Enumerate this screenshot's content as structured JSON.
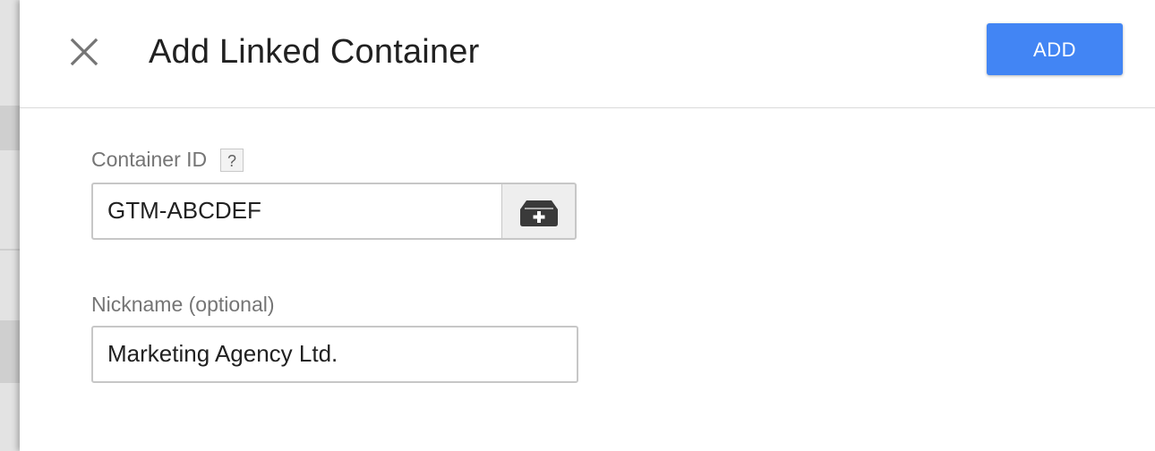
{
  "dialog": {
    "title": "Add Linked Container",
    "close_icon": "close-icon",
    "add_label": "ADD",
    "accent_color": "#4285f4"
  },
  "form": {
    "container_id": {
      "label": "Container ID",
      "help": "?",
      "value": "GTM-ABCDEF",
      "picker_icon": "container-add-icon"
    },
    "nickname": {
      "label": "Nickname (optional)",
      "value": "Marketing Agency Ltd."
    }
  }
}
